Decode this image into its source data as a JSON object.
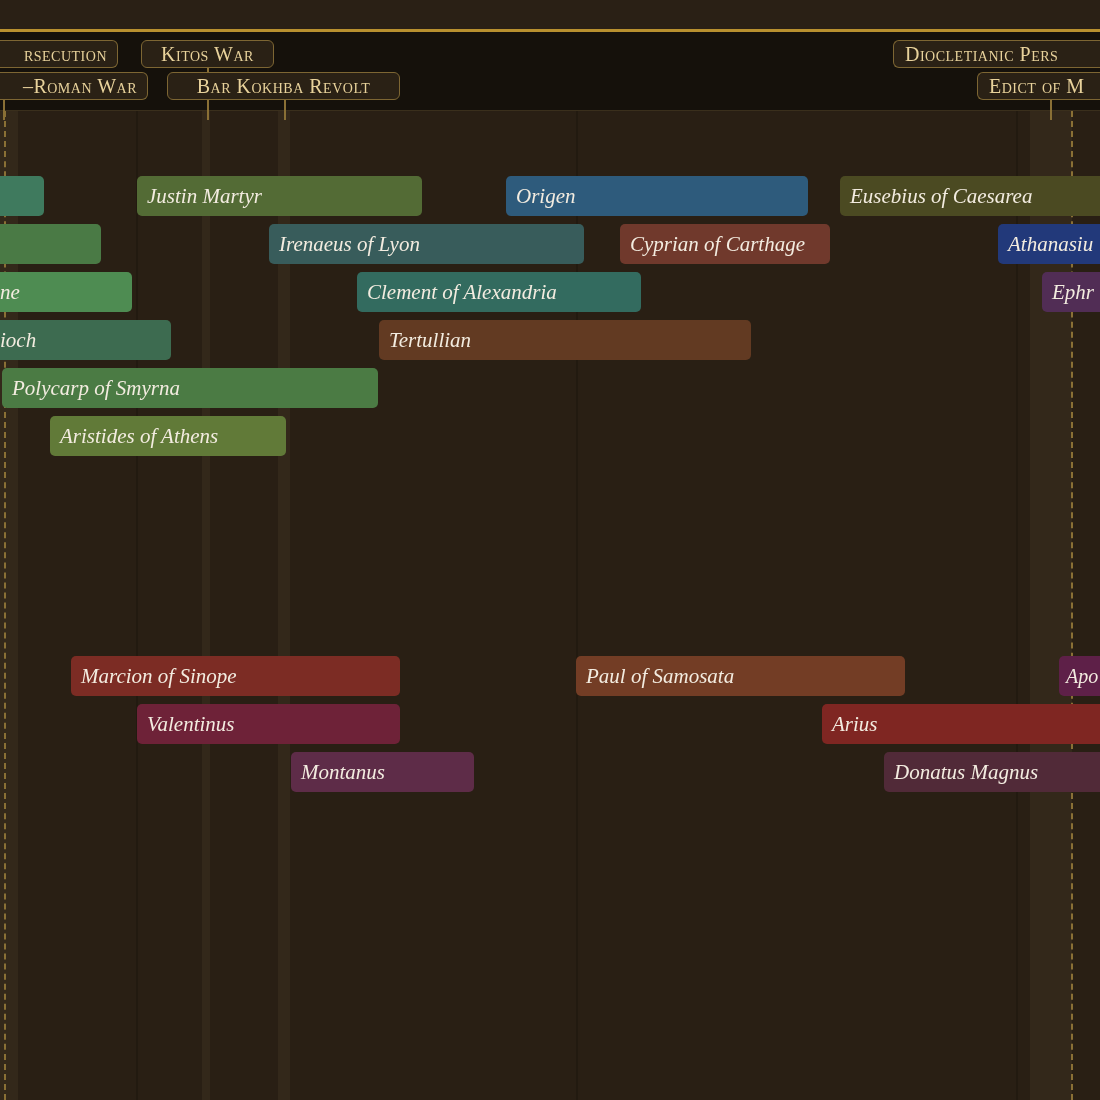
{
  "events": [
    {
      "label": "rsecution"
    },
    {
      "label": "Kitos War"
    },
    {
      "label": "Diocletianic Pers"
    },
    {
      "label": "–Roman War"
    },
    {
      "label": "Bar Kokhba Revolt"
    },
    {
      "label": "Edict of M"
    }
  ],
  "bars": [
    {
      "color": "#3f7a5e"
    },
    {
      "label": "Justin Martyr",
      "color": "#536b35"
    },
    {
      "label": "Origen",
      "color": "#2e5b7c"
    },
    {
      "label": "Eusebius of Caesarea",
      "color": "#4b4a22"
    },
    {
      "color": "#4a7a45"
    },
    {
      "label": "Irenaeus of Lyon",
      "color": "#385c5b"
    },
    {
      "label": "Cyprian of Carthage",
      "color": "#70392c"
    },
    {
      "label": "Athanasiu",
      "color": "#22397a"
    },
    {
      "label": "ne",
      "color": "#4e8c52"
    },
    {
      "label": "Clement of Alexandria",
      "color": "#336b5f"
    },
    {
      "label": "Ephr",
      "color": "#512d55"
    },
    {
      "label": "ioch",
      "color": "#3d6b50"
    },
    {
      "label": "Tertullian",
      "color": "#623a22"
    },
    {
      "label": "Polycarp of Smyrna",
      "color": "#4b7b44"
    },
    {
      "label": "Aristides of Athens",
      "color": "#617a38"
    },
    {
      "label": "Marcion of Sinope",
      "color": "#7c2c24"
    },
    {
      "label": "Paul of Samosata",
      "color": "#733d25"
    },
    {
      "label": "Apo",
      "color": "#5e2048"
    },
    {
      "label": "Valentinus",
      "color": "#6e2238"
    },
    {
      "label": "Arius",
      "color": "#7f2622"
    },
    {
      "label": "Montanus",
      "color": "#5e2c48"
    },
    {
      "label": "Donatus Magnus",
      "color": "#512a38"
    }
  ]
}
